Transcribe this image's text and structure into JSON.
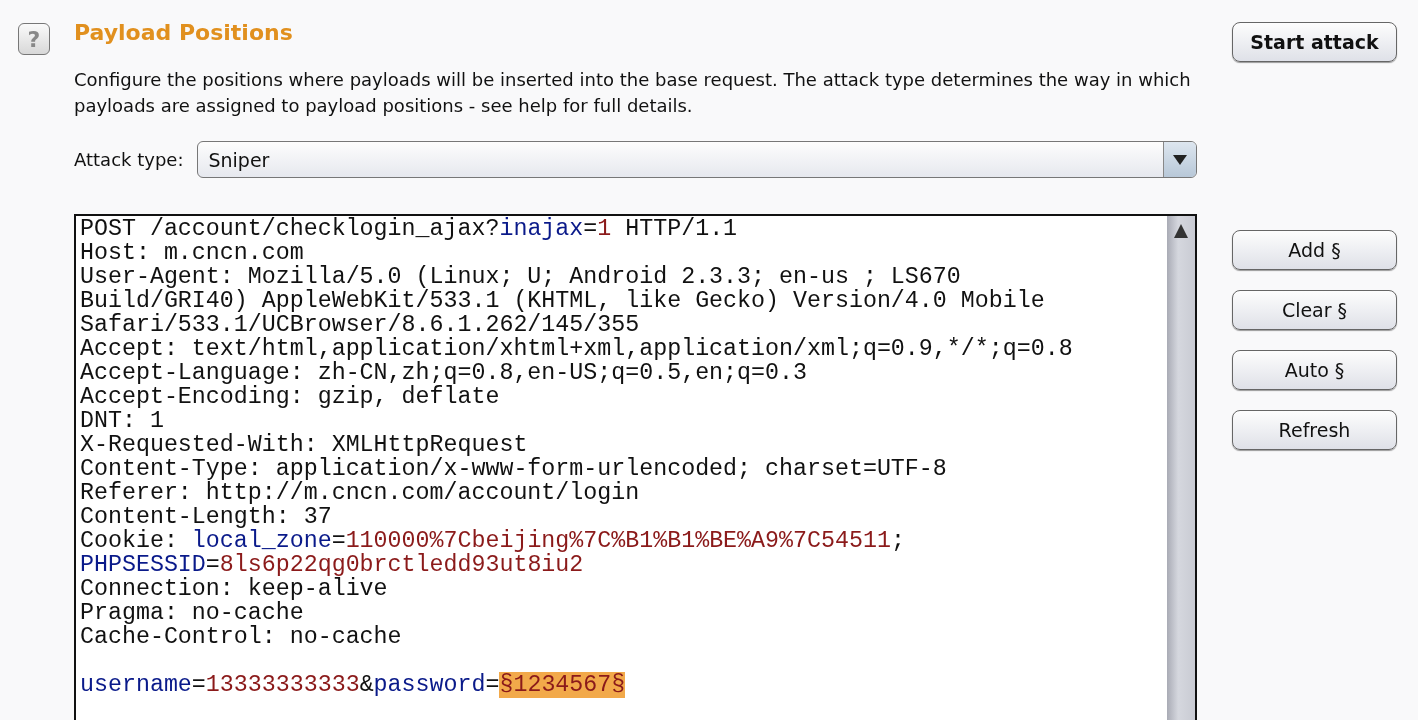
{
  "header": {
    "help_icon": "?",
    "title": "Payload Positions",
    "description": "Configure the positions where payloads will be inserted into the base request. The attack type determines the way in which payloads are assigned to payload positions - see help for full details.",
    "start_button": "Start attack"
  },
  "attack_type": {
    "label": "Attack type:",
    "value": "Sniper"
  },
  "request": {
    "headers": [
      [
        {
          "kind": "plain",
          "text": "POST /account/checklogin_ajax?"
        },
        {
          "kind": "name",
          "text": "inajax"
        },
        {
          "kind": "plain",
          "text": "="
        },
        {
          "kind": "value",
          "text": "1"
        },
        {
          "kind": "plain",
          "text": " HTTP/1.1"
        }
      ],
      [
        {
          "kind": "plain",
          "text": "Host: m.cncn.com"
        }
      ],
      [
        {
          "kind": "plain",
          "text": "User-Agent: Mozilla/5.0 (Linux; U; Android 2.3.3; en-us ; LS670"
        }
      ],
      [
        {
          "kind": "plain",
          "text": "Build/GRI40) AppleWebKit/533.1 (KHTML, like Gecko) Version/4.0 Mobile"
        }
      ],
      [
        {
          "kind": "plain",
          "text": "Safari/533.1/UCBrowser/8.6.1.262/145/355"
        }
      ],
      [
        {
          "kind": "plain",
          "text": "Accept: text/html,application/xhtml+xml,application/xml;q=0.9,*/*;q=0.8"
        }
      ],
      [
        {
          "kind": "plain",
          "text": "Accept-Language: zh-CN,zh;q=0.8,en-US;q=0.5,en;q=0.3"
        }
      ],
      [
        {
          "kind": "plain",
          "text": "Accept-Encoding: gzip, deflate"
        }
      ],
      [
        {
          "kind": "plain",
          "text": "DNT: 1"
        }
      ],
      [
        {
          "kind": "plain",
          "text": "X-Requested-With: XMLHttpRequest"
        }
      ],
      [
        {
          "kind": "plain",
          "text": "Content-Type: application/x-www-form-urlencoded; charset=UTF-8"
        }
      ],
      [
        {
          "kind": "plain",
          "text": "Referer: http://m.cncn.com/account/login"
        }
      ],
      [
        {
          "kind": "plain",
          "text": "Content-Length: 37"
        }
      ],
      [
        {
          "kind": "plain",
          "text": "Cookie: "
        },
        {
          "kind": "name",
          "text": "local_zone"
        },
        {
          "kind": "plain",
          "text": "="
        },
        {
          "kind": "value",
          "text": "110000%7Cbeijing%7C%B1%B1%BE%A9%7C54511"
        },
        {
          "kind": "plain",
          "text": ";"
        }
      ],
      [
        {
          "kind": "name",
          "text": "PHPSESSID"
        },
        {
          "kind": "plain",
          "text": "="
        },
        {
          "kind": "value",
          "text": "8ls6p22qg0brctledd93ut8iu2"
        }
      ],
      [
        {
          "kind": "plain",
          "text": "Connection: keep-alive"
        }
      ],
      [
        {
          "kind": "plain",
          "text": "Pragma: no-cache"
        }
      ],
      [
        {
          "kind": "plain",
          "text": "Cache-Control: no-cache"
        }
      ]
    ],
    "body": [
      {
        "kind": "name",
        "text": "username"
      },
      {
        "kind": "plain",
        "text": "="
      },
      {
        "kind": "value",
        "text": "13333333333"
      },
      {
        "kind": "plain",
        "text": "&"
      },
      {
        "kind": "name",
        "text": "password"
      },
      {
        "kind": "plain",
        "text": "="
      },
      {
        "kind": "marker",
        "text": "§1234567§"
      }
    ]
  },
  "side_buttons": [
    "Add §",
    "Clear §",
    "Auto §",
    "Refresh"
  ]
}
